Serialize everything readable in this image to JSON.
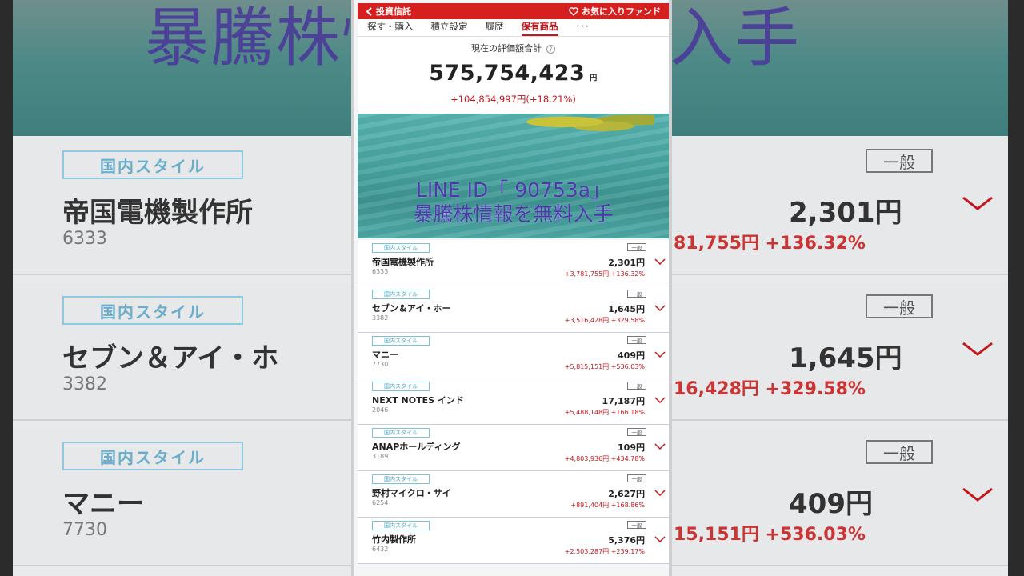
{
  "header": {
    "back_label": "投資信託",
    "favorite_label": "お気に入りファンド"
  },
  "tabs": [
    {
      "label": "探す・購入"
    },
    {
      "label": "積立設定"
    },
    {
      "label": "履歴"
    },
    {
      "label": "保有商品"
    },
    {
      "label": "･･･"
    }
  ],
  "summary": {
    "label": "現在の評価額合計",
    "help": "?",
    "total": "575,754,423",
    "unit": "円",
    "gain": "+104,854,997円(+18.21%)"
  },
  "banner": {
    "line1": "LINE ID「 90753a」",
    "line2": "暴騰株情報を無料入手"
  },
  "holdings": [
    {
      "tag": "国内スタイル",
      "account": "一般",
      "name": "帝国電機製作所",
      "code": "6333",
      "price": "2,301円",
      "change": "+3,781,755円 +136.32%"
    },
    {
      "tag": "国内スタイル",
      "account": "一般",
      "name": "セブン＆アイ・ホー",
      "code": "3382",
      "price": "1,645円",
      "change": "+3,516,428円 +329.58%"
    },
    {
      "tag": "国内スタイル",
      "account": "一般",
      "name": "マニー",
      "code": "7730",
      "price": "409円",
      "change": "+5,815,151円 +536.03%"
    },
    {
      "tag": "国内スタイル",
      "account": "一般",
      "name": "NEXT NOTES インド",
      "code": "2046",
      "price": "17,187円",
      "change": "+5,488,148円 +166.18%"
    },
    {
      "tag": "国内スタイル",
      "account": "一般",
      "name": "ANAPホールディング",
      "code": "3189",
      "price": "109円",
      "change": "+4,803,936円 +434.78%"
    },
    {
      "tag": "国内スタイル",
      "account": "一般",
      "name": "野村マイクロ・サイ",
      "code": "6254",
      "price": "2,627円",
      "change": "+891,404円 +168.86%"
    },
    {
      "tag": "国内スタイル",
      "account": "一般",
      "name": "竹内製作所",
      "code": "6432",
      "price": "5,376円",
      "change": "+2,503,287円 +239.17%"
    }
  ],
  "background": {
    "overlay_text": "暴騰株情報を無料入手",
    "cards": [
      {
        "tag": "国内スタイル",
        "account": "一般",
        "name": "帝国電機製作所",
        "code": "6333",
        "price": "2,301円",
        "change": "81,755円 +136.32%"
      },
      {
        "tag": "国内スタイル",
        "account": "一般",
        "name": "セブン＆アイ・ホ",
        "code": "3382",
        "price": "1,645円",
        "change": "16,428円 +329.58%"
      },
      {
        "tag": "国内スタイル",
        "account": "一般",
        "name": "マニー",
        "code": "7730",
        "price": "409円",
        "change": "15,151円 +536.03%"
      }
    ]
  },
  "colors": {
    "brand_red": "#d61f1f",
    "gain_red": "#c4161c",
    "tag_blue": "#47a6c6",
    "overlay_purple": "#4b3aa8"
  }
}
